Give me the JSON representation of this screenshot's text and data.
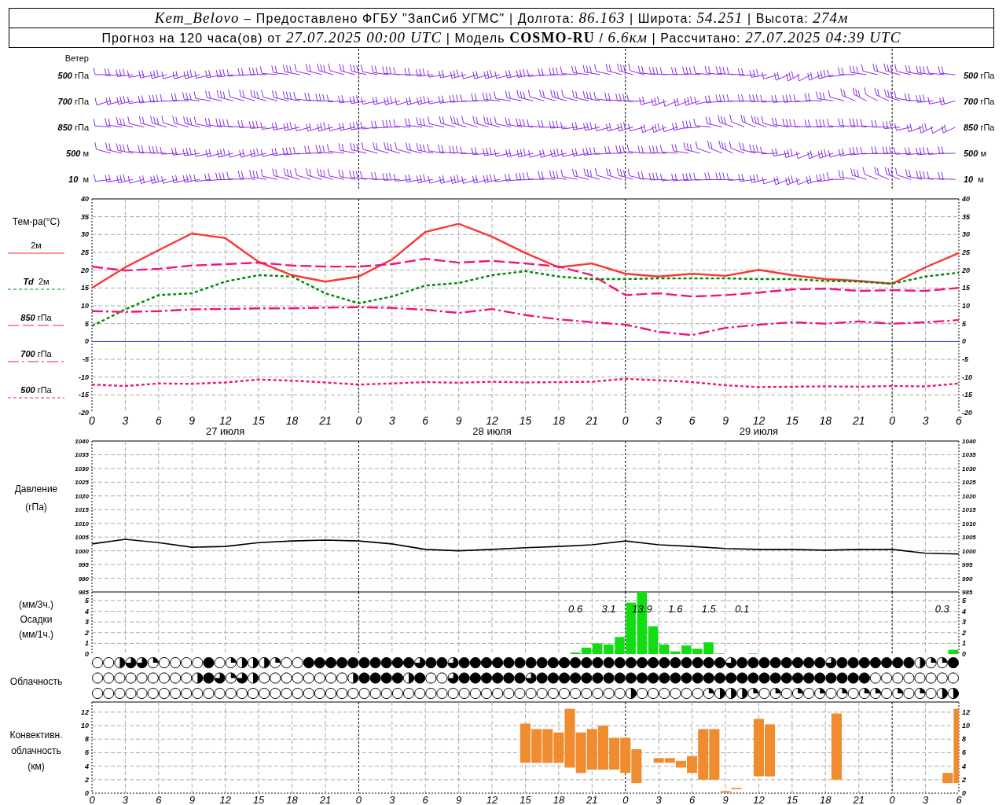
{
  "header": {
    "lines": [
      "*Kem_Belovo* – Предоставлено ФГБУ \"ЗапСиб УГМС\" | Долгота: *86.163* | Широта: *54.251* | Высота: *274м*",
      "Прогноз на 120 часа(ов) от *27.07.2025 00:00 UTC*  | Модель **COSMO-RU** / *6.6км* | Рассчитано: *27.07.2025 04:39 UTC*"
    ]
  },
  "wind": {
    "title": "Ветер",
    "left_labels": [
      "*500* гПа",
      "*700* гПа",
      "*850* гПа",
      "*500* м",
      "*10*  м"
    ],
    "right_labels": [
      "*500* гПа",
      "*700* гПа",
      "*850* гПа",
      "*500* м",
      "*10*  м"
    ]
  },
  "temperature": {
    "chart_data": {
      "type": "line",
      "ylabel": "Тем-ра(°C)",
      "grid": true,
      "categories": [
        "0",
        "3",
        "6",
        "9",
        "12",
        "15",
        "18",
        "21",
        "0",
        "3",
        "6",
        "9",
        "12",
        "15",
        "18",
        "21",
        "0",
        "3",
        "6",
        "9",
        "12",
        "15",
        "18",
        "21",
        "0",
        "3",
        "6"
      ],
      "ylim": [
        -20,
        40
      ],
      "yticks": [
        -20,
        -15,
        -10,
        -5,
        0,
        5,
        10,
        15,
        20,
        25,
        30,
        35,
        40
      ],
      "ref_lines": [
        {
          "axis": "y",
          "value": 0,
          "color": "#3344ff"
        }
      ],
      "series": [
        {
          "name": "2м",
          "color": "#ff3333",
          "line_style": "solid",
          "values": [
            15,
            20.8,
            25.6,
            30.3,
            29,
            22.3,
            18.6,
            16.8,
            18.2,
            23,
            30.7,
            33,
            29.4,
            24.8,
            20.8,
            21.9,
            19,
            18.2,
            19,
            18.4,
            20.1,
            18.6,
            17.5,
            17,
            16.2,
            20.8,
            24.8
          ]
        },
        {
          "name": "**Td**  2м",
          "color": "#008800",
          "line_style": "dotted",
          "values": [
            4.3,
            9,
            13,
            13.5,
            16.8,
            18.6,
            18.2,
            13.5,
            10.7,
            12.6,
            15.7,
            16.4,
            18.6,
            19.7,
            18.2,
            17.5,
            17.5,
            17.7,
            17.7,
            17.7,
            17.5,
            17.5,
            17,
            16.8,
            16.2,
            18.2,
            19.3
          ]
        },
        {
          "name": "*850* гПа",
          "color": "#f0157d",
          "line_style": "dashed",
          "values": [
            21,
            19.9,
            20.4,
            21.3,
            21.7,
            22.1,
            21.3,
            21,
            21,
            21.7,
            23.2,
            22.1,
            22.6,
            21.9,
            21,
            18.6,
            13,
            13.5,
            12.6,
            13,
            13.7,
            14.6,
            14.8,
            14.2,
            14.4,
            14.2,
            15
          ]
        },
        {
          "name": "*700* гПа",
          "color": "#f0157d",
          "line_style": "dashdot",
          "values": [
            8.5,
            8.3,
            8.5,
            9,
            9.1,
            9.3,
            9.3,
            9.5,
            9.6,
            9.4,
            8.9,
            8,
            9.1,
            7.4,
            6.2,
            5.4,
            4.7,
            2.7,
            1.8,
            3.8,
            4.7,
            5.4,
            5,
            5.6,
            5,
            5.4,
            6
          ]
        },
        {
          "name": "*500* гПа",
          "color": "#f0157d",
          "line_style": "dotted",
          "values": [
            -12.1,
            -12.5,
            -11.8,
            -11.9,
            -11.5,
            -10.7,
            -11,
            -11.5,
            -12.1,
            -11.8,
            -11.4,
            -11.6,
            -11.3,
            -11.5,
            -11.4,
            -11.3,
            -10.5,
            -10.9,
            -11.4,
            -12.3,
            -12.8,
            -12.7,
            -12.6,
            -12.7,
            -12.5,
            -12.6,
            -11.8
          ]
        }
      ],
      "annotations": [
        "27 июля",
        "28 июля",
        "29 июля"
      ]
    },
    "right_axis_labels": [
      "40",
      "35",
      "30",
      "25",
      "20",
      "15",
      "10",
      "5",
      "0",
      "-5",
      "-10",
      "-15",
      "-20"
    ]
  },
  "pressure": {
    "chart_data": {
      "type": "line",
      "ylabel": "Давление\n(гПа)",
      "grid": true,
      "categories": [
        null,
        null,
        null,
        null,
        null,
        null,
        null,
        null,
        null,
        null,
        null,
        null,
        null,
        null,
        null,
        null,
        null,
        null,
        null,
        null,
        null,
        null,
        null,
        null,
        null,
        null,
        null
      ],
      "values": [
        1002.5,
        1004.2,
        1003,
        1001.3,
        1001.6,
        1003,
        1003.6,
        1003.9,
        1003.6,
        1002.5,
        1000.5,
        1000,
        1000.5,
        1001.1,
        1001.6,
        1002.2,
        1003.6,
        1002.2,
        1001.6,
        1000.8,
        1000.5,
        1000.5,
        1000.2,
        1000.5,
        1000.5,
        999.1,
        998.8
      ],
      "ylim": [
        985,
        1040
      ],
      "yticks": [
        985,
        990,
        995,
        1000,
        1005,
        1010,
        1015,
        1020,
        1025,
        1030,
        1035,
        1040
      ]
    },
    "right_axis_labels": [
      "1040",
      "1035",
      "1030",
      "1025",
      "1020",
      "1015",
      "1010",
      "1005",
      "1000",
      "995",
      "990",
      "985"
    ]
  },
  "precipitation": {
    "chart_data": {
      "type": "bar",
      "ylabel": "(мм/3ч.)\nОсадки\n(мм/1ч.)",
      "grid": true,
      "categories": [
        null,
        null,
        null,
        null,
        null,
        null,
        null,
        null,
        null,
        null,
        null,
        null,
        null,
        null,
        null,
        null,
        null,
        null,
        null,
        null,
        null,
        null,
        null,
        null,
        null,
        null,
        null,
        null,
        null,
        null,
        null,
        null,
        null,
        null,
        null,
        null,
        null,
        null,
        null,
        null,
        null,
        null,
        null,
        null,
        null,
        null,
        null,
        null,
        null,
        null,
        null,
        null,
        null,
        null,
        null,
        null,
        null,
        null,
        null,
        null,
        null,
        null,
        null,
        null,
        null,
        null,
        null,
        null,
        null,
        null,
        null,
        null,
        null,
        null,
        null,
        null,
        null,
        null
      ],
      "series": [
        {
          "color": "#11dd11",
          "values": [
            null,
            null,
            null,
            null,
            null,
            null,
            null,
            null,
            null,
            null,
            null,
            null,
            null,
            null,
            null,
            null,
            null,
            null,
            null,
            null,
            null,
            null,
            null,
            null,
            null,
            null,
            null,
            null,
            null,
            null,
            null,
            null,
            null,
            null,
            null,
            null,
            null,
            null,
            null,
            null,
            null,
            null,
            null,
            0.15,
            0.6,
            1.0,
            0.9,
            1.6,
            4.8,
            5.8,
            2.6,
            0.9,
            0.25,
            0.8,
            0.5,
            1.1,
            0.05,
            null,
            null,
            0.05,
            null,
            null,
            null,
            null,
            null,
            null,
            null,
            null,
            null,
            null,
            null,
            null,
            null,
            null,
            null,
            null,
            null,
            0.4
          ]
        }
      ],
      "ylim": [
        0,
        5.8
      ],
      "yticks": [
        0,
        1,
        2,
        3,
        4,
        5
      ],
      "annotations": [
        "0.6",
        "3.1",
        "13.9",
        "1.6",
        "1.5",
        "0.1",
        "0.3"
      ]
    },
    "right_axis_labels": [
      "5",
      "4",
      "3",
      "2",
      "1",
      "0"
    ]
  },
  "clouds": {
    "title": "Облачность",
    "rows": [
      {
        "cells": [
          {
            "kind": "clear"
          },
          {
            "kind": "clear"
          },
          {
            "kind": "half"
          },
          {
            "kind": "most"
          },
          {
            "kind": "most"
          },
          {
            "kind": "quarter"
          },
          {
            "kind": "clear"
          },
          {
            "kind": "clear"
          },
          {
            "kind": "clear"
          },
          {
            "kind": "clear"
          },
          {
            "kind": "overcast"
          },
          {
            "kind": "clear"
          },
          {
            "kind": "quarter"
          },
          {
            "kind": "half"
          },
          {
            "kind": "half"
          },
          {
            "kind": "half"
          },
          {
            "kind": "quarter"
          },
          {
            "kind": "clear"
          },
          {
            "kind": "clear"
          },
          {
            "kind": "overcast"
          },
          {
            "kind": "overcast"
          },
          {
            "kind": "overcast"
          },
          {
            "kind": "overcast"
          },
          {
            "kind": "overcast"
          },
          {
            "kind": "overcast"
          },
          {
            "kind": "overcast"
          },
          {
            "kind": "overcast"
          },
          {
            "kind": "overcast"
          },
          {
            "kind": "overcast"
          },
          {
            "kind": "most"
          },
          {
            "kind": "overcast"
          },
          {
            "kind": "overcast"
          },
          {
            "kind": "most"
          },
          {
            "kind": "overcast"
          },
          {
            "kind": "overcast"
          },
          {
            "kind": "overcast"
          },
          {
            "kind": "overcast"
          },
          {
            "kind": "overcast"
          },
          {
            "kind": "overcast"
          },
          {
            "kind": "overcast"
          },
          {
            "kind": "overcast"
          },
          {
            "kind": "overcast"
          },
          {
            "kind": "overcast"
          },
          {
            "kind": "overcast"
          },
          {
            "kind": "overcast"
          },
          {
            "kind": "overcast"
          },
          {
            "kind": "overcast"
          },
          {
            "kind": "overcast"
          },
          {
            "kind": "overcast"
          },
          {
            "kind": "overcast"
          },
          {
            "kind": "overcast"
          },
          {
            "kind": "overcast"
          },
          {
            "kind": "overcast"
          },
          {
            "kind": "overcast"
          },
          {
            "kind": "overcast"
          },
          {
            "kind": "overcast"
          },
          {
            "kind": "overcast"
          },
          {
            "kind": "most"
          },
          {
            "kind": "overcast"
          },
          {
            "kind": "overcast"
          },
          {
            "kind": "overcast"
          },
          {
            "kind": "overcast"
          },
          {
            "kind": "overcast"
          },
          {
            "kind": "overcast"
          },
          {
            "kind": "overcast"
          },
          {
            "kind": "overcast"
          },
          {
            "kind": "most"
          },
          {
            "kind": "overcast"
          },
          {
            "kind": "overcast"
          },
          {
            "kind": "overcast"
          },
          {
            "kind": "overcast"
          },
          {
            "kind": "overcast"
          },
          {
            "kind": "overcast"
          },
          {
            "kind": "overcast"
          },
          {
            "kind": "half"
          },
          {
            "kind": "quarter"
          },
          {
            "kind": "quarter"
          },
          {
            "kind": "overcast"
          }
        ]
      },
      {
        "cells": [
          {
            "kind": "clear"
          },
          {
            "kind": "clear"
          },
          {
            "kind": "clear"
          },
          {
            "kind": "clear"
          },
          {
            "kind": "clear"
          },
          {
            "kind": "clear"
          },
          {
            "kind": "clear"
          },
          {
            "kind": "clear"
          },
          {
            "kind": "clear"
          },
          {
            "kind": "half"
          },
          {
            "kind": "overcast"
          },
          {
            "kind": "most"
          },
          {
            "kind": "quarter"
          },
          {
            "kind": "most"
          },
          {
            "kind": "half"
          },
          {
            "kind": "clear"
          },
          {
            "kind": "clear"
          },
          {
            "kind": "clear"
          },
          {
            "kind": "clear"
          },
          {
            "kind": "clear"
          },
          {
            "kind": "clear"
          },
          {
            "kind": "clear"
          },
          {
            "kind": "clear"
          },
          {
            "kind": "half"
          },
          {
            "kind": "overcast"
          },
          {
            "kind": "overcast"
          },
          {
            "kind": "overcast"
          },
          {
            "kind": "overcast"
          },
          {
            "kind": "half"
          },
          {
            "kind": "overcast"
          },
          {
            "kind": "clear"
          },
          {
            "kind": "clear"
          },
          {
            "kind": "most"
          },
          {
            "kind": "overcast"
          },
          {
            "kind": "overcast"
          },
          {
            "kind": "overcast"
          },
          {
            "kind": "overcast"
          },
          {
            "kind": "overcast"
          },
          {
            "kind": "overcast"
          },
          {
            "kind": "most"
          },
          {
            "kind": "overcast"
          },
          {
            "kind": "overcast"
          },
          {
            "kind": "overcast"
          },
          {
            "kind": "overcast"
          },
          {
            "kind": "overcast"
          },
          {
            "kind": "overcast"
          },
          {
            "kind": "overcast"
          },
          {
            "kind": "overcast"
          },
          {
            "kind": "overcast"
          },
          {
            "kind": "overcast"
          },
          {
            "kind": "overcast"
          },
          {
            "kind": "overcast"
          },
          {
            "kind": "overcast"
          },
          {
            "kind": "overcast"
          },
          {
            "kind": "overcast"
          },
          {
            "kind": "overcast"
          },
          {
            "kind": "overcast"
          },
          {
            "kind": "overcast"
          },
          {
            "kind": "overcast"
          },
          {
            "kind": "overcast"
          },
          {
            "kind": "overcast"
          },
          {
            "kind": "overcast"
          },
          {
            "kind": "overcast"
          },
          {
            "kind": "overcast"
          },
          {
            "kind": "overcast"
          },
          {
            "kind": "overcast"
          },
          {
            "kind": "overcast"
          },
          {
            "kind": "overcast"
          },
          {
            "kind": "overcast"
          },
          {
            "kind": "overcast"
          },
          {
            "kind": "clear"
          },
          {
            "kind": "clear"
          },
          {
            "kind": "clear"
          },
          {
            "kind": "clear"
          },
          {
            "kind": "clear"
          },
          {
            "kind": "clear"
          },
          {
            "kind": "clear"
          },
          {
            "kind": "clear"
          }
        ]
      },
      {
        "cells": [
          {
            "kind": "clear"
          },
          {
            "kind": "clear"
          },
          {
            "kind": "clear"
          },
          {
            "kind": "clear"
          },
          {
            "kind": "clear"
          },
          {
            "kind": "clear"
          },
          {
            "kind": "clear"
          },
          {
            "kind": "clear"
          },
          {
            "kind": "clear"
          },
          {
            "kind": "clear"
          },
          {
            "kind": "clear"
          },
          {
            "kind": "clear"
          },
          {
            "kind": "clear"
          },
          {
            "kind": "clear"
          },
          {
            "kind": "clear"
          },
          {
            "kind": "clear"
          },
          {
            "kind": "clear"
          },
          {
            "kind": "clear"
          },
          {
            "kind": "clear"
          },
          {
            "kind": "clear"
          },
          {
            "kind": "clear"
          },
          {
            "kind": "clear"
          },
          {
            "kind": "clear"
          },
          {
            "kind": "clear"
          },
          {
            "kind": "clear"
          },
          {
            "kind": "clear"
          },
          {
            "kind": "clear"
          },
          {
            "kind": "clear"
          },
          {
            "kind": "clear"
          },
          {
            "kind": "clear"
          },
          {
            "kind": "clear"
          },
          {
            "kind": "clear"
          },
          {
            "kind": "clear"
          },
          {
            "kind": "clear"
          },
          {
            "kind": "clear"
          },
          {
            "kind": "clear"
          },
          {
            "kind": "clear"
          },
          {
            "kind": "clear"
          },
          {
            "kind": "clear"
          },
          {
            "kind": "clear"
          },
          {
            "kind": "clear"
          },
          {
            "kind": "clear"
          },
          {
            "kind": "clear"
          },
          {
            "kind": "clear"
          },
          {
            "kind": "clear"
          },
          {
            "kind": "clear"
          },
          {
            "kind": "clear"
          },
          {
            "kind": "clear"
          },
          {
            "kind": "half"
          },
          {
            "kind": "clear"
          },
          {
            "kind": "clear"
          },
          {
            "kind": "clear"
          },
          {
            "kind": "clear"
          },
          {
            "kind": "clear"
          },
          {
            "kind": "clear"
          },
          {
            "kind": "quarter"
          },
          {
            "kind": "half"
          },
          {
            "kind": "half"
          },
          {
            "kind": "half"
          },
          {
            "kind": "quarter"
          },
          {
            "kind": "clear"
          },
          {
            "kind": "quarter"
          },
          {
            "kind": "clear"
          },
          {
            "kind": "quarter"
          },
          {
            "kind": "clear"
          },
          {
            "kind": "quarter"
          },
          {
            "kind": "clear"
          },
          {
            "kind": "quarter"
          },
          {
            "kind": "clear"
          },
          {
            "kind": "quarter"
          },
          {
            "kind": "quarter"
          },
          {
            "kind": "clear"
          },
          {
            "kind": "quarter"
          },
          {
            "kind": "clear"
          },
          {
            "kind": "quarter"
          },
          {
            "kind": "clear"
          },
          {
            "kind": "half"
          },
          {
            "kind": "half"
          }
        ]
      }
    ]
  },
  "convective": {
    "chart_data": {
      "type": "candlestick",
      "ylabel": "Конвективн.\nоблачность\n(км)",
      "grid": true,
      "categories": [
        "0",
        null,
        null,
        "3",
        null,
        null,
        "6",
        null,
        null,
        "9",
        null,
        null,
        "12",
        null,
        null,
        "15",
        null,
        null,
        "18",
        null,
        null,
        "21",
        null,
        null,
        "0",
        null,
        null,
        "3",
        null,
        null,
        "6",
        null,
        null,
        "9",
        null,
        null,
        "12",
        null,
        null,
        "15",
        null,
        null,
        "18",
        null,
        null,
        "21",
        null,
        null,
        "0",
        null,
        null,
        "3",
        null,
        null,
        "6",
        null,
        null,
        "9",
        null,
        null,
        "12",
        null,
        null,
        "15",
        null,
        null,
        "18",
        null,
        null,
        "21",
        null,
        null,
        "0",
        null,
        null,
        "3",
        null,
        null,
        "6"
      ],
      "series": [
        {
          "color": "#f08c30",
          "ohlc": [
            null,
            null,
            null,
            null,
            null,
            null,
            null,
            null,
            null,
            null,
            null,
            null,
            null,
            null,
            null,
            null,
            null,
            null,
            null,
            null,
            null,
            null,
            null,
            null,
            null,
            null,
            null,
            null,
            null,
            null,
            null,
            null,
            null,
            null,
            null,
            null,
            null,
            null,
            null,
            [
              4.5,
              10.3,
              4.5,
              10.3
            ],
            [
              4.5,
              9.5,
              4.5,
              9.5
            ],
            [
              4.5,
              9.5,
              4.5,
              9.5
            ],
            [
              4.5,
              9,
              4.5,
              9
            ],
            [
              3.8,
              12.5,
              3.8,
              12.5
            ],
            [
              3,
              9,
              3,
              9
            ],
            [
              3.5,
              9.5,
              3.5,
              9.5
            ],
            [
              3.5,
              10,
              3.5,
              10
            ],
            [
              3.5,
              8.2,
              3.5,
              8.2
            ],
            [
              3,
              8.2,
              3,
              8.2
            ],
            [
              1.5,
              6.5,
              1.5,
              6.5
            ],
            null,
            [
              4.5,
              5.2,
              4.5,
              5.2
            ],
            [
              4.5,
              5.2,
              4.5,
              5.2
            ],
            [
              3.8,
              4.8,
              3.8,
              4.8
            ],
            [
              3,
              5.5,
              3,
              5.5
            ],
            [
              2,
              9.5,
              2,
              9.5
            ],
            [
              2,
              9.5,
              2,
              9.5
            ],
            [
              0.1,
              0.3,
              0.1,
              0.3
            ],
            [
              0.6,
              0.8,
              0.6,
              0.8
            ],
            null,
            [
              2.5,
              11,
              2.5,
              11
            ],
            [
              2.5,
              10.2,
              2.5,
              10.2
            ],
            null,
            null,
            null,
            null,
            null,
            [
              2,
              11.8,
              2,
              11.8
            ],
            null,
            null,
            null,
            null,
            null,
            null,
            null,
            null,
            null,
            [
              1.5,
              3,
              1.5,
              3
            ],
            [
              1.5,
              12.5,
              1.5,
              12.5
            ]
          ]
        }
      ],
      "ylim": [
        0,
        13.5
      ],
      "yticks": [
        0,
        2,
        4,
        6,
        8,
        10,
        12
      ]
    },
    "right_axis_labels": [
      "12",
      "10",
      "8",
      "6",
      "4",
      "2",
      "0"
    ]
  }
}
